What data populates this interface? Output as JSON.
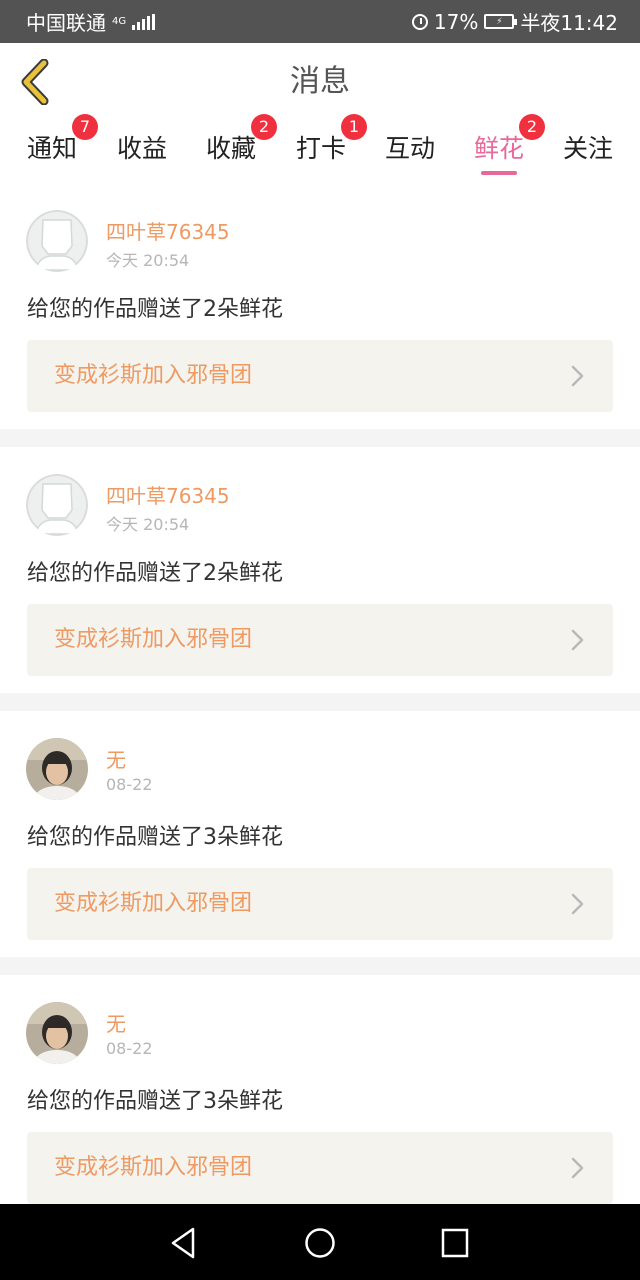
{
  "status_bar": {
    "carrier": "中国联通",
    "network": "4G",
    "battery": "17%",
    "time": "半夜11:42"
  },
  "header": {
    "title": "消息"
  },
  "tabs": [
    {
      "label": "通知",
      "badge": "7"
    },
    {
      "label": "收益",
      "badge": ""
    },
    {
      "label": "收藏",
      "badge": "2"
    },
    {
      "label": "打卡",
      "badge": "1"
    },
    {
      "label": "互动",
      "badge": ""
    },
    {
      "label": "鲜花",
      "badge": "2",
      "active": true
    },
    {
      "label": "关注",
      "badge": ""
    }
  ],
  "messages": [
    {
      "user": "四叶草76345",
      "time": "今天 20:54",
      "text": "给您的作品赠送了2朵鲜花",
      "work": "变成衫斯加入邪骨团",
      "avatar": "default-avatar"
    },
    {
      "user": "四叶草76345",
      "time": "今天 20:54",
      "text": "给您的作品赠送了2朵鲜花",
      "work": "变成衫斯加入邪骨团",
      "avatar": "default-avatar"
    },
    {
      "user": "无",
      "time": "08-22",
      "text": "给您的作品赠送了3朵鲜花",
      "work": "变成衫斯加入邪骨团",
      "avatar": "photo-avatar"
    },
    {
      "user": "无",
      "time": "08-22",
      "text": "给您的作品赠送了3朵鲜花",
      "work": "变成衫斯加入邪骨团",
      "avatar": "photo-avatar"
    }
  ],
  "colors": {
    "accent": "#e8689a",
    "username": "#ee9a62",
    "badge": "#f0303f",
    "work_box": "#f4f3ee",
    "back_arrow": "#e9c23b"
  }
}
